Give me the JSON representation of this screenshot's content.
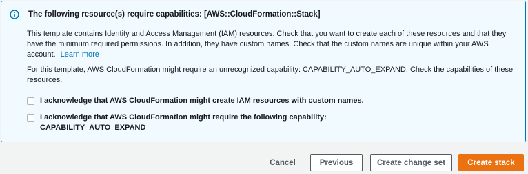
{
  "alert": {
    "title": "The following resource(s) require capabilities: [AWS::CloudFormation::Stack]",
    "paragraph1": "This template contains Identity and Access Management (IAM) resources. Check that you want to create each of these resources and that they have the minimum required permissions. In addition, they have custom names. Check that the custom names are unique within your AWS account.",
    "learn_more": "Learn more",
    "paragraph2": "For this template, AWS CloudFormation might require an unrecognized capability: CAPABILITY_AUTO_EXPAND. Check the capabilities of these resources.",
    "icon": "info-icon",
    "accent_color": "#0073bb"
  },
  "checkboxes": [
    {
      "label": "I acknowledge that AWS CloudFormation might create IAM resources with custom names.",
      "checked": false
    },
    {
      "label_line1": "I acknowledge that AWS CloudFormation might require the following capability:",
      "label_line2": "CAPABILITY_AUTO_EXPAND",
      "checked": false
    }
  ],
  "footer": {
    "cancel_label": "Cancel",
    "previous_label": "Previous",
    "change_set_label": "Create change set",
    "create_label": "Create stack",
    "primary_color": "#ec7211"
  }
}
